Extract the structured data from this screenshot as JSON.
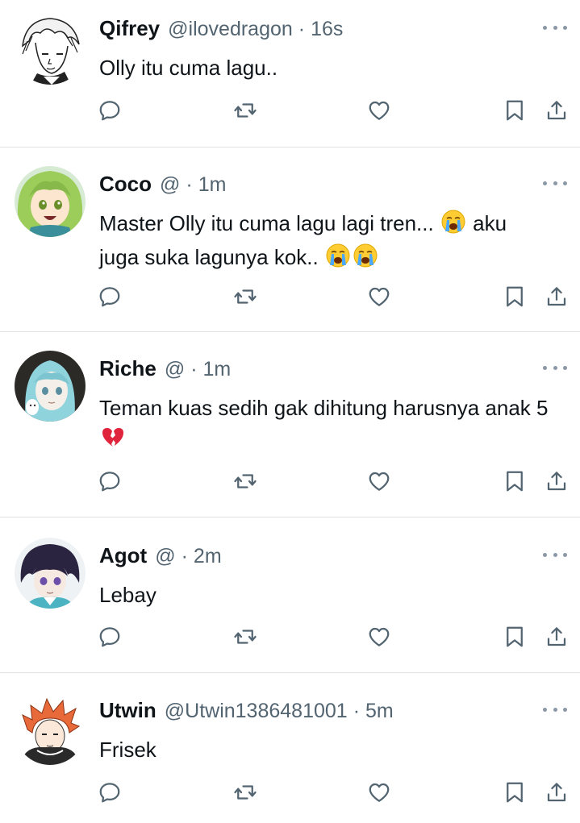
{
  "tweets": [
    {
      "name": "Qifrey",
      "handle": "@ilovedragon",
      "separator": "·",
      "time": "16s",
      "text": "Olly itu cuma lagu..",
      "avatar": "avatar-manga-boy"
    },
    {
      "name": "Coco",
      "handle": "@",
      "separator": "·",
      "time": "1m",
      "text_parts": [
        "Master Olly itu cuma lagu lagi tren... ",
        " aku juga suka lagunya kok.. "
      ],
      "emojis": [
        "loudly-crying-face",
        "loudly-crying-face",
        "loudly-crying-face"
      ],
      "avatar": "avatar-green-hair-girl"
    },
    {
      "name": "Riche",
      "handle": "@",
      "separator": "·",
      "time": "1m",
      "text_parts": [
        "Teman kuas sedih gak dihitung harusnya anak 5 "
      ],
      "emojis": [
        "broken-heart"
      ],
      "avatar": "avatar-blue-hood-girl"
    },
    {
      "name": "Agot",
      "handle": "@",
      "separator": "·",
      "time": "2m",
      "text": "Lebay",
      "avatar": "avatar-dark-hair-boy"
    },
    {
      "name": "Utwin",
      "handle": "@Utwin1386481001",
      "separator": "·",
      "time": "5m",
      "text": "Frisek",
      "avatar": "avatar-orange-hair-boy"
    }
  ],
  "action_icons": [
    "reply-icon",
    "retweet-icon",
    "like-icon",
    "bookmark-icon",
    "share-icon"
  ],
  "colors": {
    "text": "#0f1419",
    "secondary": "#536471",
    "divider": "#dfe3e6",
    "icon": "#536471"
  }
}
